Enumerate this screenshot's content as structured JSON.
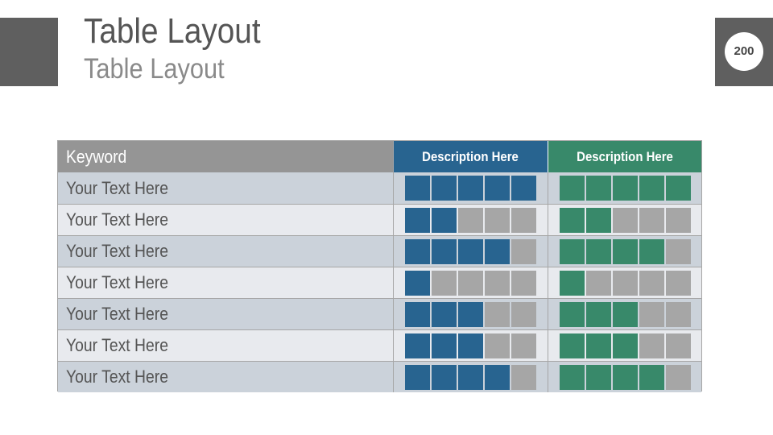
{
  "header": {
    "title": "Table Layout",
    "subtitle": "Table Layout",
    "page_number": "200"
  },
  "table": {
    "headers": {
      "keyword": "Keyword",
      "col1": "Description Here",
      "col2": "Description Here"
    },
    "segments_total": 5,
    "colors": {
      "blue": "#286490",
      "green": "#38896a",
      "empty": "#a6a6a6",
      "keyword_header": "#959595",
      "row_odd": "#cbd2da",
      "row_even": "#e8eaee"
    },
    "rows": [
      {
        "label": "Your Text Here",
        "col1": 5,
        "col2": 5
      },
      {
        "label": "Your Text Here",
        "col1": 2,
        "col2": 2
      },
      {
        "label": "Your Text Here",
        "col1": 4,
        "col2": 4
      },
      {
        "label": "Your Text Here",
        "col1": 1,
        "col2": 1
      },
      {
        "label": "Your Text Here",
        "col1": 3,
        "col2": 3
      },
      {
        "label": "Your Text Here",
        "col1": 3,
        "col2": 3
      },
      {
        "label": "Your Text Here",
        "col1": 4,
        "col2": 4
      }
    ]
  }
}
